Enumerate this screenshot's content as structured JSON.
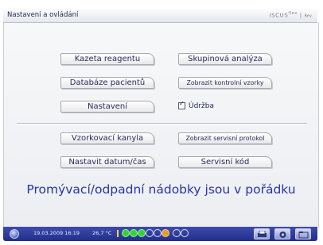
{
  "window": {
    "title": "Nastavení a ovládání",
    "brand": "ISCUS",
    "brand_superscript": "flex",
    "brand_rev": "Rev."
  },
  "buttons": {
    "reagent_cassette": "Kazeta reagentu",
    "group_analysis": "Skupinová analýza",
    "patient_database": "Databáze pacientů",
    "show_control_samples": "Zobrazit kontrolní vzorky",
    "settings": "Nastavení",
    "sample_cannula": "Vzorkovací kanyla",
    "show_service_protocol": "Zobrazit servisní protokol",
    "set_datetime": "Nastavit datum/čas",
    "service_code": "Servisní kód"
  },
  "maintenance_checkbox": {
    "label": "Údržba",
    "checked": true
  },
  "status_message": "Promývací/odpadní nádobky jsou v pořádku",
  "statusbar": {
    "datetime": "19.03.2009 16:19",
    "temperature": "26,7 °C",
    "sample_positions": [
      "filled",
      "filled",
      "filled",
      "empty",
      "empty",
      "occupied-orange",
      "empty",
      "empty"
    ]
  },
  "colors": {
    "status_text": "#2a34a5",
    "statusbar_bg": "#2d3a98",
    "sample_filled": "#36d13c",
    "sample_occupied": "#e59a2a"
  }
}
